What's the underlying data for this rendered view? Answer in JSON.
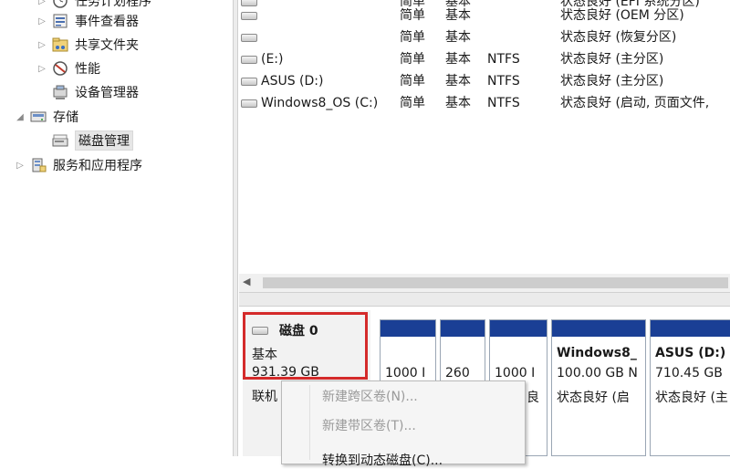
{
  "tree": {
    "items": [
      {
        "label": "任务计划程序",
        "expander": "▷",
        "icon": "clock-icon"
      },
      {
        "label": "事件查看器",
        "expander": "▷",
        "icon": "event-viewer-icon"
      },
      {
        "label": "共享文件夹",
        "expander": "▷",
        "icon": "shared-folder-icon"
      },
      {
        "label": "性能",
        "expander": "▷",
        "icon": "performance-icon"
      },
      {
        "label": "设备管理器",
        "expander": "",
        "icon": "device-manager-icon"
      },
      {
        "label": "存储",
        "expander": "◢",
        "icon": "storage-icon"
      },
      {
        "label": "磁盘管理",
        "expander": "",
        "icon": "disk-management-icon"
      },
      {
        "label": "服务和应用程序",
        "expander": "▷",
        "icon": "services-icon"
      }
    ]
  },
  "volumes": {
    "rows": [
      {
        "name": "",
        "layout": "简单",
        "type": "基本",
        "fs": "",
        "status": "状态良好 (EFI 系统分区)"
      },
      {
        "name": "",
        "layout": "简单",
        "type": "基本",
        "fs": "",
        "status": "状态良好 (OEM 分区)"
      },
      {
        "name": "",
        "layout": "简单",
        "type": "基本",
        "fs": "",
        "status": "状态良好 (恢复分区)"
      },
      {
        "name": "(E:)",
        "layout": "简单",
        "type": "基本",
        "fs": "NTFS",
        "status": "状态良好 (主分区)"
      },
      {
        "name": "ASUS (D:)",
        "layout": "简单",
        "type": "基本",
        "fs": "NTFS",
        "status": "状态良好 (主分区)"
      },
      {
        "name": "Windows8_OS (C:)",
        "layout": "简单",
        "type": "基本",
        "fs": "NTFS",
        "status": "状态良好 (启动, 页面文件,"
      }
    ]
  },
  "disk": {
    "name": "磁盘 0",
    "type": "基本",
    "size": "931.39 GB",
    "state": "联机"
  },
  "partitions": [
    {
      "line1": "",
      "line2": "1000 I",
      "line3": ""
    },
    {
      "line1": "",
      "line2": "260",
      "line3": ""
    },
    {
      "line1": "",
      "line2": "1000 I",
      "line3": "良"
    },
    {
      "line1": "Windows8_",
      "line2": "100.00 GB N",
      "line3": "状态良好 (启"
    },
    {
      "line1": "ASUS  (D:)",
      "line2": "710.45 GB",
      "line3": "状态良好 (主"
    }
  ],
  "context_menu": {
    "items": [
      {
        "label": "新建跨区卷(N)...",
        "enabled": false
      },
      {
        "label": "新建带区卷(T)...",
        "enabled": false
      },
      {
        "label": "转换到动态磁盘(C)...",
        "enabled": true
      }
    ]
  },
  "colors": {
    "partition_bar": "#1a3f95",
    "highlight": "#d42a2a"
  }
}
